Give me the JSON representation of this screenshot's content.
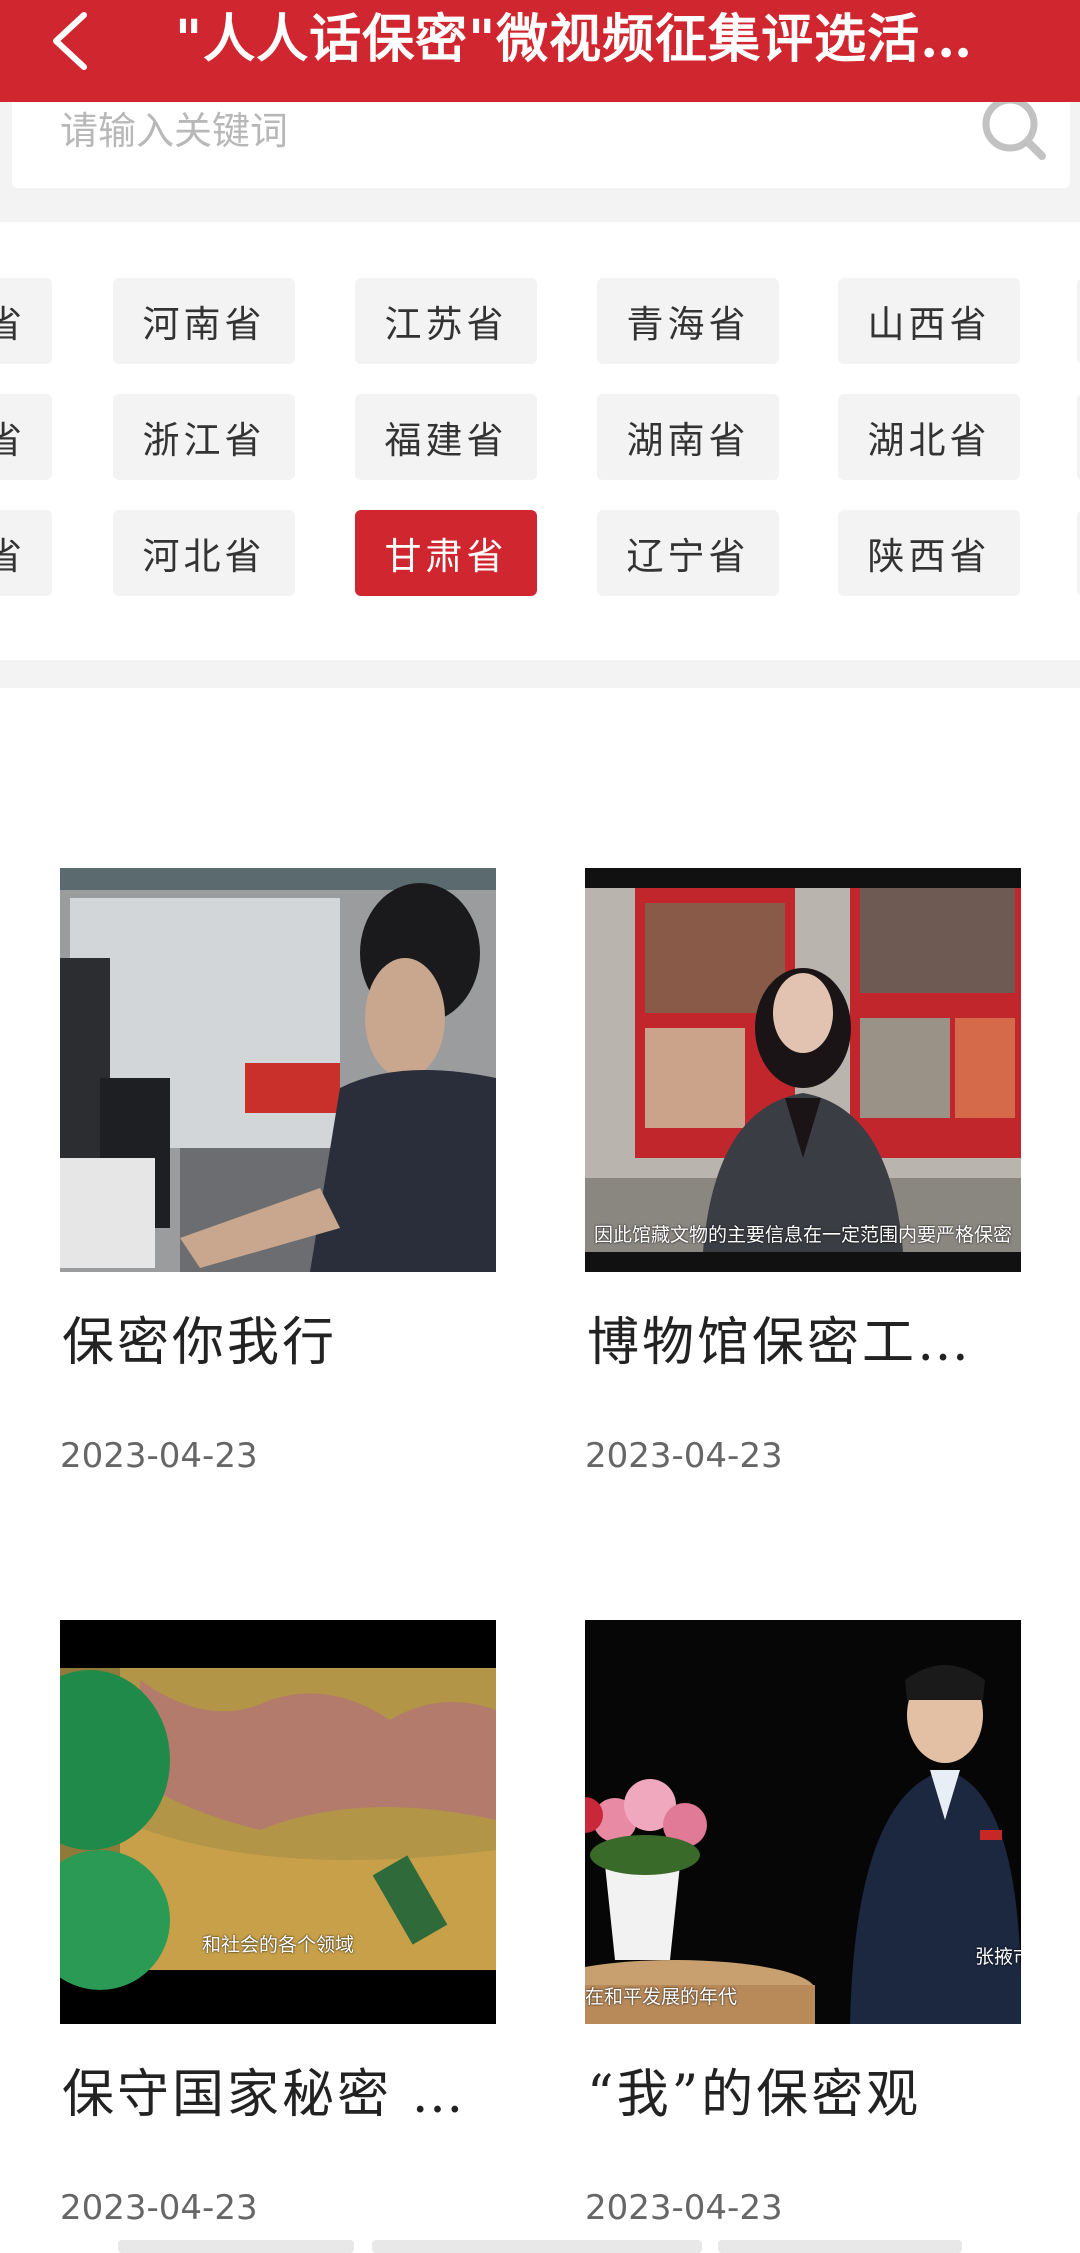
{
  "header": {
    "title": "\"人人话保密\"微视频征集评选活…"
  },
  "search": {
    "placeholder": "请输入关键词"
  },
  "provinces": {
    "rows": [
      [
        "河南省",
        "江苏省",
        "青海省",
        "山西省"
      ],
      [
        "浙江省",
        "福建省",
        "湖南省",
        "湖北省"
      ],
      [
        "河北省",
        "甘肃省",
        "辽宁省",
        "陕西省"
      ]
    ],
    "partial_left": [
      "省",
      "省",
      "省"
    ],
    "selected": "甘肃省"
  },
  "videos": [
    {
      "title": "保密你我行",
      "date": "2023-04-23",
      "caption": ""
    },
    {
      "title": "博物馆保密工…",
      "date": "2023-04-23",
      "caption": "因此馆藏文物的主要信息在一定范围内要严格保密"
    },
    {
      "title": "保守国家秘密 …",
      "date": "2023-04-23",
      "caption": "和社会的各个领域"
    },
    {
      "title": "“我”的保密观",
      "date": "2023-04-23",
      "caption": "在和平发展的年代",
      "side_label": "张掖市"
    }
  ],
  "colors": {
    "brand_red": "#d0262f",
    "chip_bg": "#f3f3f3"
  },
  "icons": {
    "back": "back-chevron-icon",
    "search": "search-icon"
  }
}
